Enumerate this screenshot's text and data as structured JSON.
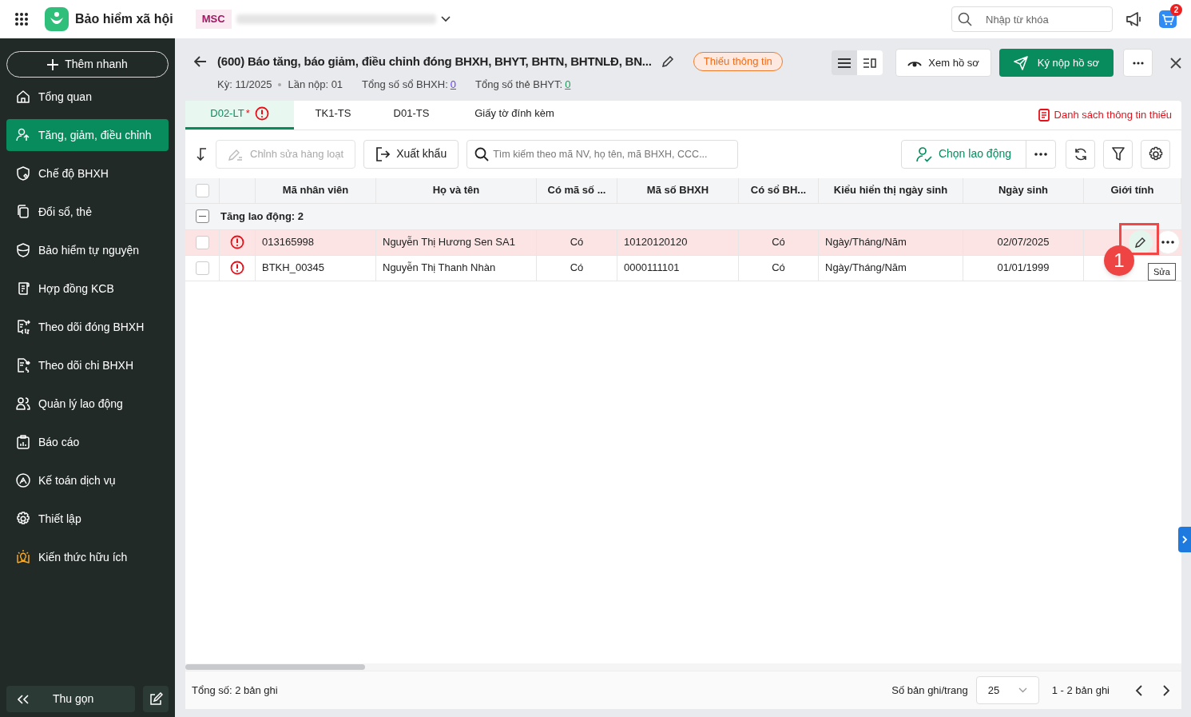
{
  "app": {
    "title": "Bảo hiểm xã hội",
    "tenant_code": "MSC",
    "search_placeholder": "Nhập từ khóa",
    "cart_count": "2"
  },
  "sidebar": {
    "add_button": "Thêm nhanh",
    "items": [
      {
        "label": "Tổng quan",
        "selected": false
      },
      {
        "label": "Tăng, giảm, điều chỉnh",
        "selected": true
      },
      {
        "label": "Chế độ BHXH",
        "selected": false
      },
      {
        "label": "Đổi sổ, thẻ",
        "selected": false
      },
      {
        "label": "Bảo hiểm tự nguyện",
        "selected": false
      },
      {
        "label": "Hợp đồng KCB",
        "selected": false
      },
      {
        "label": "Theo dõi đóng BHXH",
        "selected": false
      },
      {
        "label": "Theo dõi chi BHXH",
        "selected": false
      },
      {
        "label": "Quản lý lao động",
        "selected": false
      },
      {
        "label": "Báo cáo",
        "selected": false
      },
      {
        "label": "Kế toán dịch vụ",
        "selected": false
      },
      {
        "label": "Thiết lập",
        "selected": false
      },
      {
        "label": "Kiến thức hữu ích",
        "selected": false
      }
    ],
    "collapse": "Thu gọn"
  },
  "header": {
    "title": "(600) Báo tăng, báo giảm, điều chỉnh đóng BHXH, BHYT, BHTN, BHTNLĐ, BN...",
    "status": "Thiếu thông tin",
    "period": "Kỳ: 11/2025",
    "submission": "Lần nộp: 01",
    "bhxh_label": "Tổng số sổ BHXH:",
    "bhxh_count": "0",
    "bhyt_label": "Tổng số thẻ BHYT:",
    "bhyt_count": "0",
    "view_button": "Xem hồ sơ",
    "submit_button": "Ký nộp hồ sơ"
  },
  "tabs": [
    {
      "label": "D02-LT",
      "marker": "*",
      "error": true,
      "selected": true
    },
    {
      "label": "TK1-TS",
      "error": false,
      "selected": false
    },
    {
      "label": "D01-TS",
      "error": false,
      "selected": false
    },
    {
      "label": "Giấy tờ đính kèm",
      "error": false,
      "selected": false
    }
  ],
  "missing_link": "Danh sách thông tin thiếu",
  "toolbar": {
    "bulk_edit": "Chỉnh sửa hàng loạt",
    "bulk_edit_disabled": true,
    "export": "Xuất khẩu",
    "search_placeholder": "Tìm kiếm theo mã NV, họ tên, mã BHXH, CCC...",
    "choose": "Chọn lao động"
  },
  "table": {
    "all_checked": false,
    "columns": [
      "Mã nhân viên",
      "Họ và tên",
      "Có mã số ...",
      "Mã số BHXH",
      "Có sổ BH...",
      "Kiểu hiển thị ngày sinh",
      "Ngày sinh",
      "Giới tính"
    ],
    "group": {
      "label": "Tăng lao động: 2",
      "expanded": true
    },
    "rows": [
      {
        "cells": [
          "013165998",
          "Nguyễn Thị Hương Sen SA1",
          "Có",
          "10120120120",
          "Có",
          "Ngày/Tháng/Năm",
          "02/07/2025"
        ],
        "error": true,
        "hovered": true,
        "checked": false
      },
      {
        "cells": [
          "BTKH_00345",
          "Nguyễn Thị Thanh Nhàn",
          "Có",
          "0000111101",
          "Có",
          "Ngày/Tháng/Năm",
          "01/01/1999"
        ],
        "error": true,
        "hovered": false,
        "checked": false
      }
    ]
  },
  "annotation": {
    "step": "1",
    "tooltip": "Sửa"
  },
  "footer": {
    "total": "Tổng số: 2 bản ghi",
    "page_size_label": "Số bản ghi/trang",
    "page_size": "25",
    "range": "1 - 2 bản ghi"
  }
}
